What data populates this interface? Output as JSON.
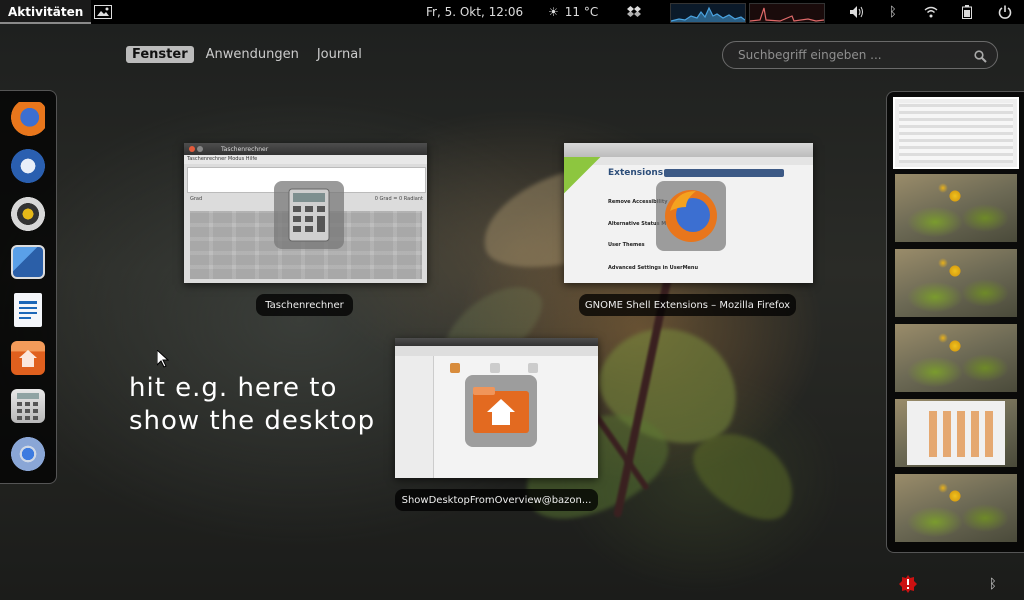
{
  "topbar": {
    "activities_label": "Aktivitäten",
    "clock": "Fr,  5. Okt, 12:06",
    "weather_temp": "11 °C"
  },
  "view_switcher": {
    "tabs": [
      {
        "label": "Fenster",
        "active": true
      },
      {
        "label": "Anwendungen",
        "active": false
      },
      {
        "label": "Journal",
        "active": false
      }
    ]
  },
  "search": {
    "placeholder": "Suchbegriff eingeben ..."
  },
  "dash": {
    "items": [
      "firefox-icon",
      "thunderbird-icon",
      "speaker-app-icon",
      "photos-icon",
      "writer-icon",
      "file-manager-icon",
      "calculator-icon",
      "chromium-icon"
    ]
  },
  "windows": [
    {
      "caption": "Taschenrechner",
      "app_icon": "calculator-icon"
    },
    {
      "caption": "GNOME Shell Extensions – Mozilla Firefox",
      "app_icon": "firefox-icon"
    },
    {
      "caption": "ShowDesktopFromOverview@bazon...",
      "app_icon": "file-manager-icon"
    }
  ],
  "calculator_thumb": {
    "title": "Taschenrechner",
    "menu": "Taschenrechner  Modus  Hilfe",
    "mode": "Grad",
    "status": "0 Grad = 0 Radiant"
  },
  "firefox_thumb": {
    "heading": "Extensions",
    "items": [
      "Remove Accessibility",
      "Alternative Status Me",
      "User Themes",
      "Advanced Settings in UserMenu"
    ]
  },
  "overlay_text": {
    "line1": "hit e.g. here to",
    "line2": "show the desktop"
  },
  "workspaces": {
    "count": 6,
    "active_index": 0
  },
  "colors": {
    "accent": "#c8c8c8",
    "topbar": "#000000",
    "alert": "#cc1111"
  }
}
